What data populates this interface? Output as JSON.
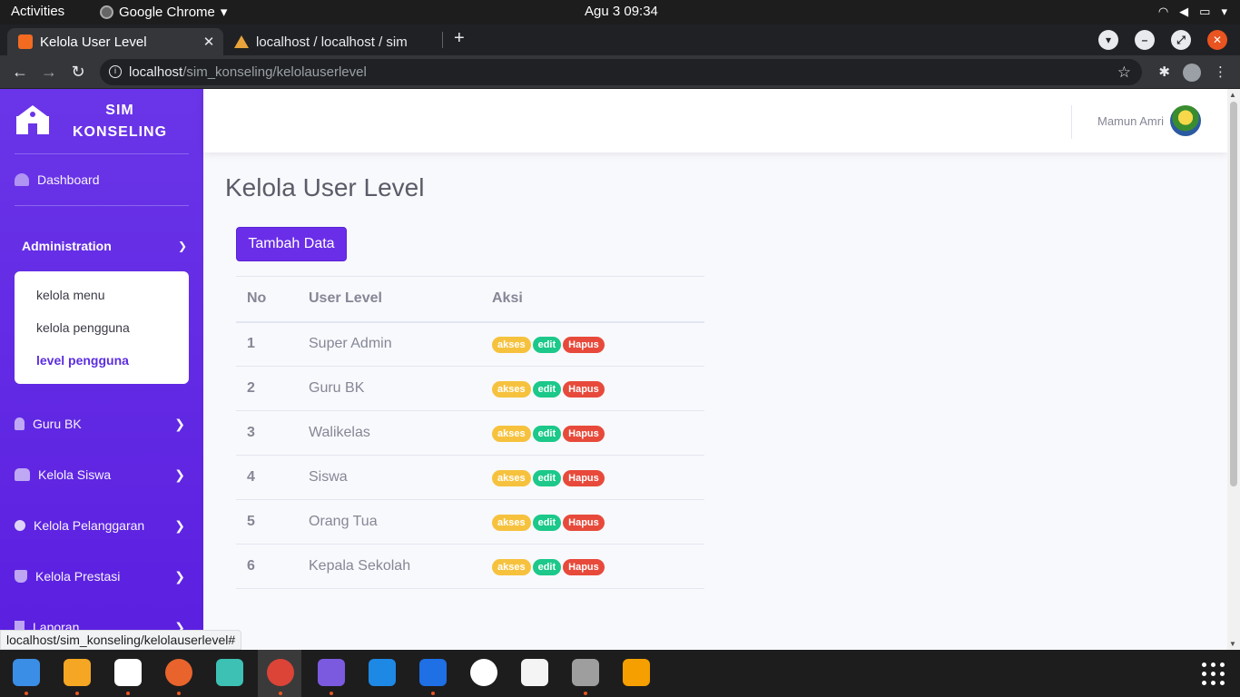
{
  "system": {
    "activities": "Activities",
    "app_menu": "Google Chrome",
    "clock": "Agu 3  09:34"
  },
  "browser": {
    "tabs": [
      {
        "title": "Kelola User Level",
        "active": true
      },
      {
        "title": "localhost / localhost / sim",
        "active": false
      }
    ],
    "url_host": "localhost",
    "url_path": "/sim_konseling/kelolauserlevel",
    "status_url": "localhost/sim_konseling/kelolauserlevel#"
  },
  "sidebar": {
    "brand_line1": "SIM",
    "brand_line2": "KONSELING",
    "dashboard": "Dashboard",
    "section_admin": "Administration",
    "admin_items": [
      {
        "label": "kelola menu",
        "active": false
      },
      {
        "label": "kelola pengguna",
        "active": false
      },
      {
        "label": "level pengguna",
        "active": true
      }
    ],
    "items": [
      {
        "label": "Guru BK",
        "icon": "user-icon"
      },
      {
        "label": "Kelola Siswa",
        "icon": "users-icon"
      },
      {
        "label": "Kelola Pelanggaran",
        "icon": "skull-icon"
      },
      {
        "label": "Kelola Prestasi",
        "icon": "trophy-icon"
      },
      {
        "label": "Laporan",
        "icon": "report-icon"
      }
    ]
  },
  "navbar": {
    "user_name": "Mamun Amri"
  },
  "main": {
    "title": "Kelola User Level",
    "add_button": "Tambah Data",
    "table": {
      "headers": [
        "No",
        "User Level",
        "Aksi"
      ],
      "rows": [
        {
          "no": "1",
          "level": "Super Admin"
        },
        {
          "no": "2",
          "level": "Guru BK"
        },
        {
          "no": "3",
          "level": "Walikelas"
        },
        {
          "no": "4",
          "level": "Siswa"
        },
        {
          "no": "5",
          "level": "Orang Tua"
        },
        {
          "no": "6",
          "level": "Kepala Sekolah"
        }
      ],
      "actions": {
        "akses": "akses",
        "edit": "edit",
        "hapus": "Hapus"
      }
    }
  },
  "colors": {
    "sidebar": "#6a35e8",
    "primary_button": "#6a2ee8",
    "badge_akses": "#f6c23e",
    "badge_edit": "#1cc88a",
    "badge_hapus": "#e74a3b"
  }
}
